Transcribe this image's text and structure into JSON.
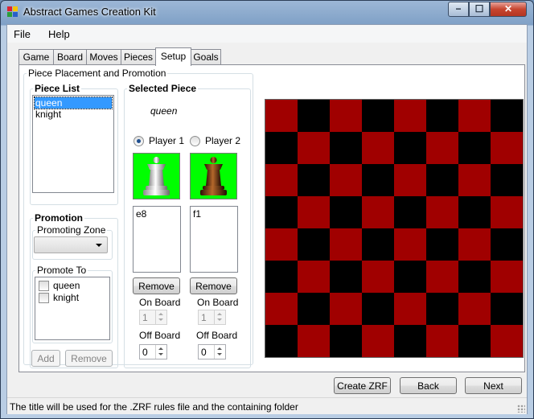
{
  "window": {
    "title": "Abstract Games Creation Kit",
    "controls": {
      "minimize": "−",
      "maximize": "☐",
      "close": "✕"
    }
  },
  "menu": [
    "File",
    "Help"
  ],
  "tabs": [
    "Game",
    "Board",
    "Moves",
    "Pieces",
    "Setup",
    "Goals"
  ],
  "active_tab": "Setup",
  "setup": {
    "group_title": "Piece Placement and Promotion",
    "piece_list": {
      "title": "Piece List",
      "items": [
        "queen",
        "knight"
      ],
      "selected": "queen"
    },
    "promotion": {
      "title": "Promotion",
      "zone_title": "Promoting Zone",
      "zone_value": "",
      "promote_to_title": "Promote To",
      "options": [
        {
          "label": "queen",
          "checked": false
        },
        {
          "label": "knight",
          "checked": false
        }
      ],
      "add_label": "Add",
      "remove_label": "Remove"
    },
    "selected_piece": {
      "title": "Selected Piece",
      "name": "queen",
      "players": [
        {
          "label": "Player 1",
          "checked": true,
          "piece_color": "white",
          "positions": "e8",
          "remove_label": "Remove",
          "on_board_label": "On Board",
          "on_board": "1",
          "off_board_label": "Off Board",
          "off_board": "0"
        },
        {
          "label": "Player 2",
          "checked": false,
          "piece_color": "brown",
          "positions": "f1",
          "remove_label": "Remove",
          "on_board_label": "On Board",
          "on_board": "1",
          "off_board_label": "Off Board",
          "off_board": "0"
        }
      ]
    },
    "board": {
      "rows": 8,
      "cols": 8,
      "color_dark": "#000000",
      "color_light": "#a00000",
      "top_left": "light"
    }
  },
  "buttons": {
    "create_zrf": "Create ZRF",
    "back": "Back",
    "next": "Next"
  },
  "status_text": "The title will be used for the .ZRF rules file and the containing folder",
  "colors": {
    "piece_background": "#00ff00",
    "selection": "#3399ff"
  }
}
